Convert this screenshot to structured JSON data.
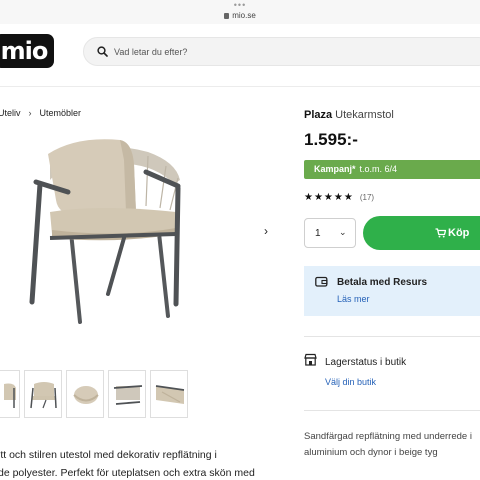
{
  "browser": {
    "dots": "•••",
    "url": "mio.se"
  },
  "header": {
    "logo": "mio",
    "search_placeholder": "Vad letar du efter?"
  },
  "breadcrumb": [
    "Uteliv",
    "Utemöbler"
  ],
  "product": {
    "name": "Plaza",
    "category": "Utekarmstol",
    "price": "1.595:-",
    "campaign_label": "Kampanj*",
    "campaign_text": "t.o.m. 6/4",
    "stars": "★★★★★",
    "review_count": "(17)",
    "quantity": "1",
    "buy_label": "Köp"
  },
  "payment": {
    "title": "Betala med Resurs",
    "link": "Läs mer"
  },
  "stock": {
    "title": "Lagerstatus i butik",
    "link": "Välj din butik"
  },
  "short_description": {
    "line1": "Sandfärgad repflätning med underrede i",
    "line2": "aluminium och dynor i beige tyg"
  },
  "description": {
    "line1": "itt och stilren utestol med dekorativ repflätning i",
    "line2": "de polyester. Perfekt för uteplatsen och extra skön med"
  },
  "colors": {
    "campaign_green": "#6aaa4c",
    "buy_green": "#2fb04a",
    "link_blue": "#2662b8",
    "payment_bg": "#e3f0fb"
  }
}
